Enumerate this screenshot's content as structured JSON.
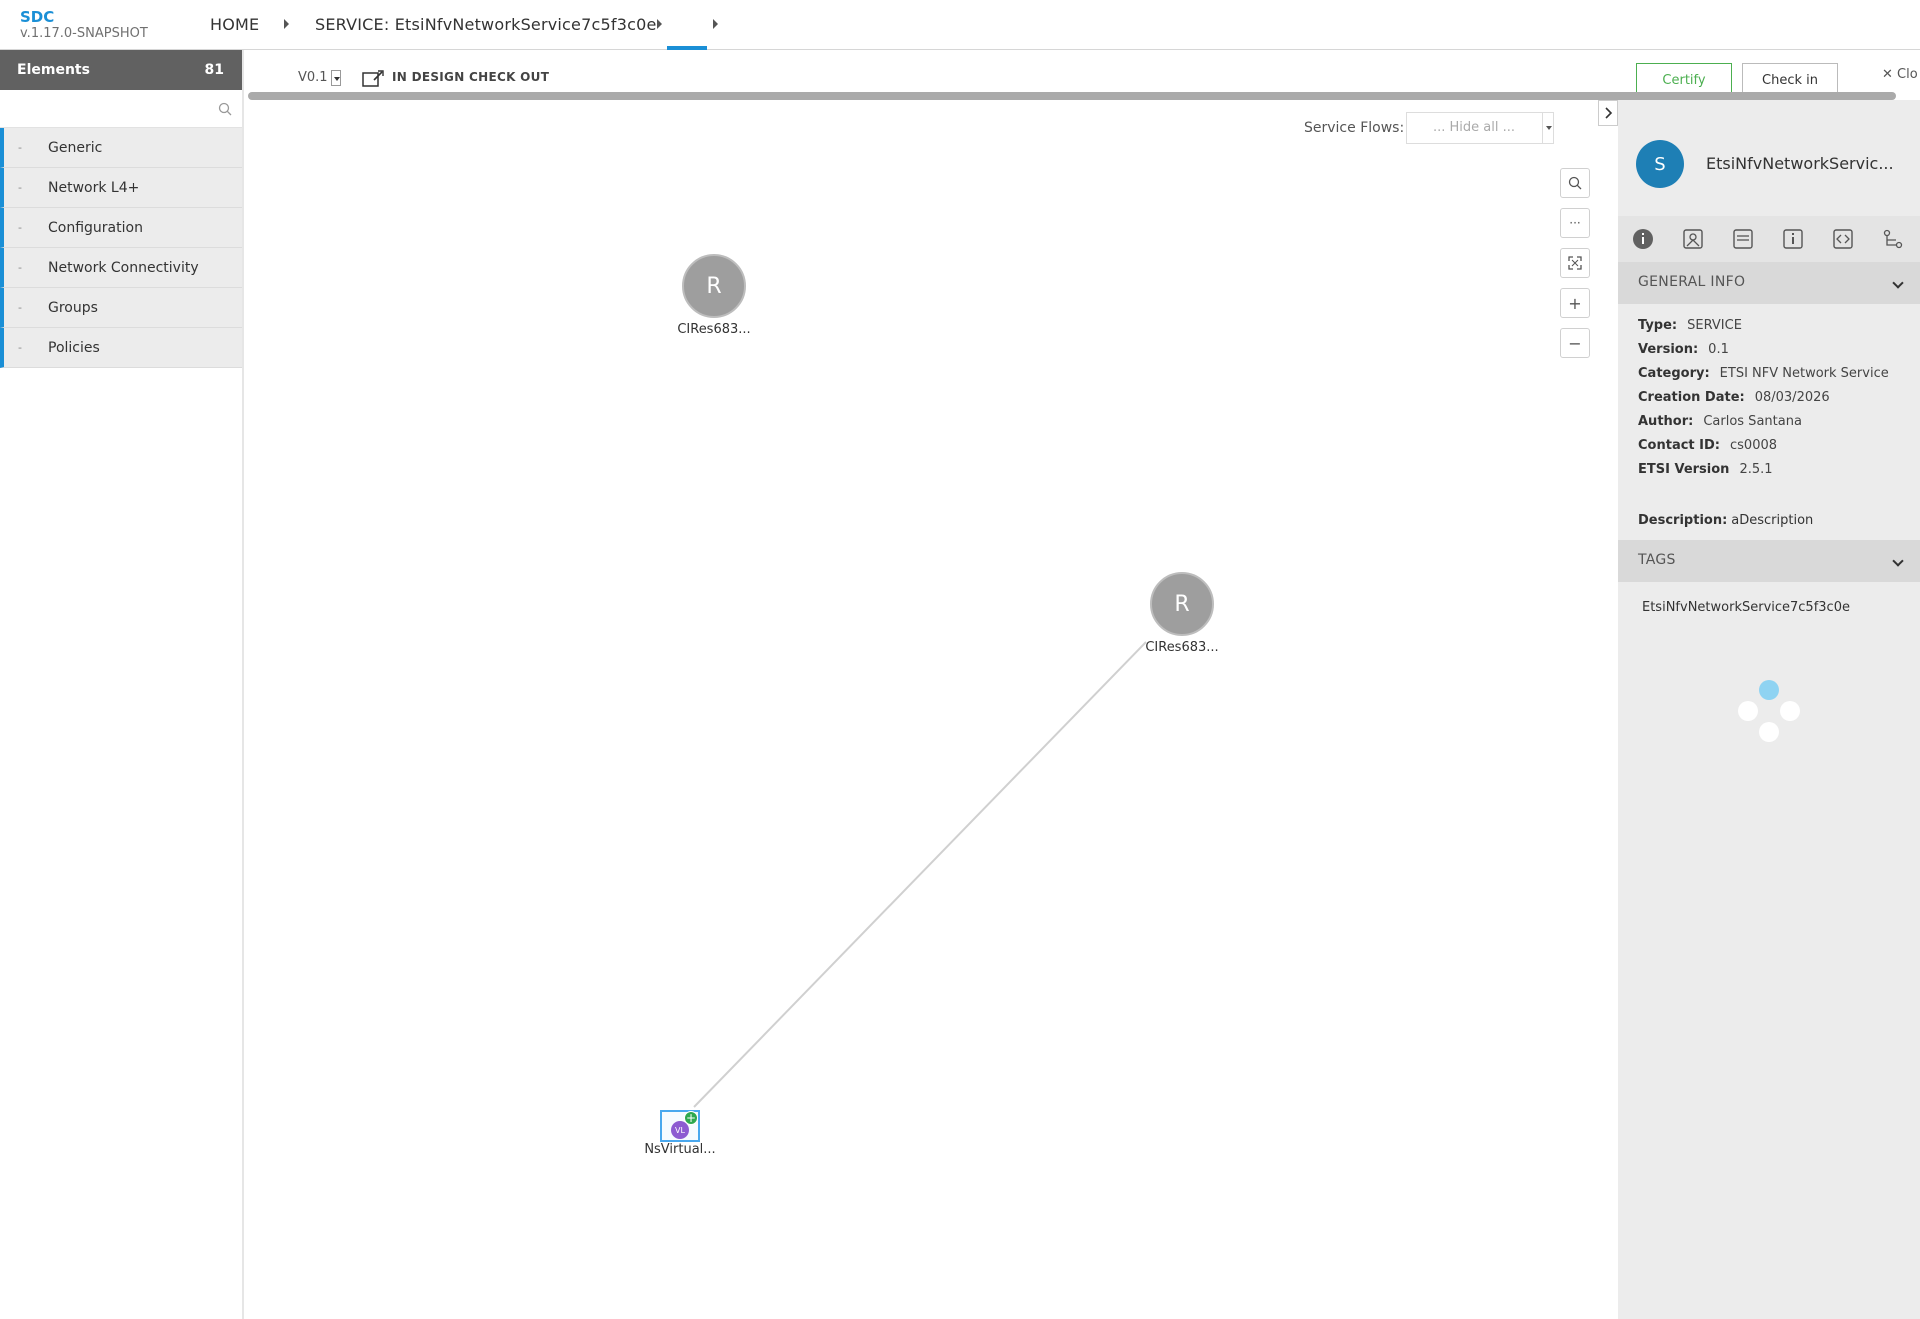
{
  "app": {
    "name": "SDC",
    "version": "v.1.17.0-SNAPSHOT"
  },
  "breadcrumb": {
    "home": "HOME",
    "service": "SERVICE: EtsiNfvNetworkService7c5f3c0e"
  },
  "palette": {
    "title": "Elements",
    "count": "81",
    "search_placeholder": "",
    "categories": [
      {
        "dash": "-",
        "label": "Generic"
      },
      {
        "dash": "-",
        "label": "Network L4+"
      },
      {
        "dash": "-",
        "label": "Configuration"
      },
      {
        "dash": "-",
        "label": "Network Connectivity"
      },
      {
        "dash": "-",
        "label": "Groups"
      },
      {
        "dash": "-",
        "label": "Policies"
      }
    ]
  },
  "toolbar": {
    "version": "V0.1",
    "status": "IN DESIGN CHECK OUT",
    "certify": "Certify",
    "checkin": "Check in",
    "close": "Clo"
  },
  "canvas": {
    "flows_label": "Service Flows:",
    "flows_value": "... Hide all ...",
    "zoom_buttons": [
      "search-icon",
      "more-icon",
      "fit-icon",
      "zoom-in-icon",
      "zoom-out-icon"
    ],
    "nodes": [
      {
        "letter": "R",
        "label": "CIRes683..."
      },
      {
        "letter": "R",
        "label": "CIRes683..."
      },
      {
        "letter": "VL",
        "label": "NsVirtual..."
      }
    ]
  },
  "details": {
    "avatar": "S",
    "title": "EtsiNfvNetworkServic...",
    "general_info_title": "GENERAL INFO",
    "info": [
      {
        "key": "Type:",
        "value": "SERVICE"
      },
      {
        "key": "Version:",
        "value": "0.1"
      },
      {
        "key": "Category:",
        "value": "ETSI NFV Network Service"
      },
      {
        "key": "Creation Date:",
        "value": "08/03/2026"
      },
      {
        "key": "Author:",
        "value": "Carlos Santana"
      },
      {
        "key": "Contact ID:",
        "value": "cs0008"
      },
      {
        "key": "ETSI Version",
        "value": "2.5.1"
      }
    ],
    "description_key": "Description:",
    "description_value": "aDescription",
    "tags_title": "TAGS",
    "tag": "EtsiNfvNetworkService7c5f3c0e"
  },
  "colors": {
    "accent": "#1a8fd6",
    "certify": "#4caf50",
    "panel_gray": "#979797",
    "node_gray": "#9e9e9e",
    "vl_purple": "#8d5bd1",
    "spinner_blue": "#8fd3f2"
  }
}
